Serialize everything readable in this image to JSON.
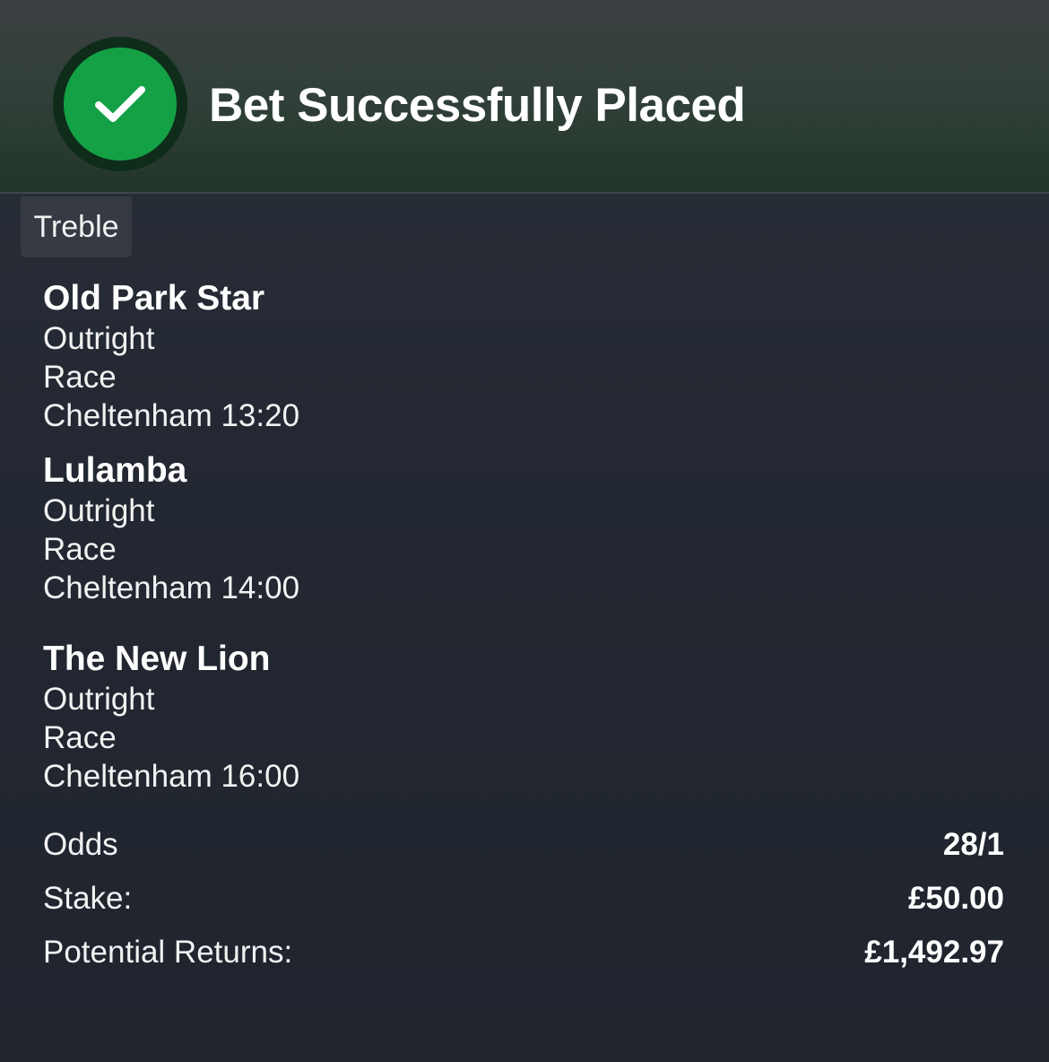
{
  "header": {
    "title": "Bet Successfully Placed",
    "status_icon": "check-icon",
    "accent_color": "#14a045"
  },
  "bet_type": "Treble",
  "selections": [
    {
      "name": "Old Park Star",
      "market": "Outright",
      "event_type": "Race",
      "event": "Cheltenham 13:20"
    },
    {
      "name": "Lulamba",
      "market": "Outright",
      "event_type": "Race",
      "event": "Cheltenham 14:00"
    },
    {
      "name": "The New Lion",
      "market": "Outright",
      "event_type": "Race",
      "event": "Cheltenham 16:00"
    }
  ],
  "summary": {
    "odds_label": "Odds",
    "odds_value": "28/1",
    "stake_label": "Stake:",
    "stake_value": "£50.00",
    "returns_label": "Potential Returns:",
    "returns_value": "£1,492.97"
  }
}
